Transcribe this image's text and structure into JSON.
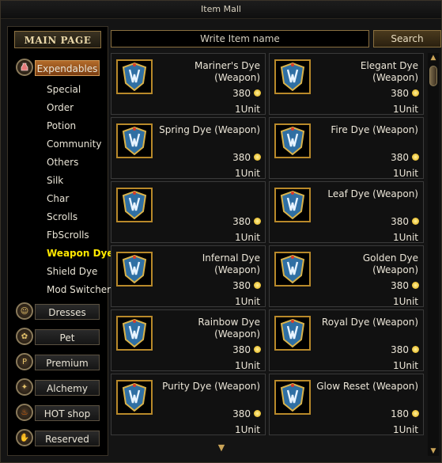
{
  "window": {
    "title": "Item Mall"
  },
  "sidebar": {
    "main_page": "MAIN PAGE",
    "categories": [
      {
        "label": "Expendables",
        "icon": "potion-icon"
      },
      {
        "label": "Dresses",
        "icon": "avatar-icon"
      },
      {
        "label": "Pet",
        "icon": "pet-icon"
      },
      {
        "label": "Premium",
        "icon": "premium-coin-icon",
        "glyph": "P"
      },
      {
        "label": "Alchemy",
        "icon": "alchemy-icon"
      },
      {
        "label": "HOT shop",
        "icon": "flame-icon"
      },
      {
        "label": "Reserved",
        "icon": "hand-icon"
      }
    ],
    "subitems": [
      "Special",
      "Order",
      "Potion",
      "Community",
      "Others",
      "Silk",
      "Char",
      "Scrolls",
      "FbScrolls",
      "Weapon Dye",
      "Shield Dye",
      "Mod Switcher"
    ],
    "active_sub": "Weapon Dye"
  },
  "search": {
    "placeholder": "Write Item name",
    "button": "Search"
  },
  "items": [
    {
      "name": "Mariner's Dye (Weapon)",
      "price": "380",
      "unit": "1Unit"
    },
    {
      "name": "Elegant Dye (Weapon)",
      "price": "380",
      "unit": "1Unit"
    },
    {
      "name": "Spring Dye (Weapon)",
      "price": "380",
      "unit": "1Unit"
    },
    {
      "name": "Fire Dye (Weapon)",
      "price": "380",
      "unit": "1Unit"
    },
    {
      "name": "",
      "price": "380",
      "unit": "1Unit"
    },
    {
      "name": "Leaf Dye (Weapon)",
      "price": "380",
      "unit": "1Unit"
    },
    {
      "name": "Infernal Dye (Weapon)",
      "price": "380",
      "unit": "1Unit"
    },
    {
      "name": "Golden Dye (Weapon)",
      "price": "380",
      "unit": "1Unit"
    },
    {
      "name": "Rainbow Dye (Weapon)",
      "price": "380",
      "unit": "1Unit"
    },
    {
      "name": "Royal Dye (Weapon)",
      "price": "380",
      "unit": "1Unit"
    },
    {
      "name": "Purity Dye (Weapon)",
      "price": "380",
      "unit": "1Unit"
    },
    {
      "name": "Glow Reset (Weapon)",
      "price": "180",
      "unit": "1Unit"
    }
  ]
}
